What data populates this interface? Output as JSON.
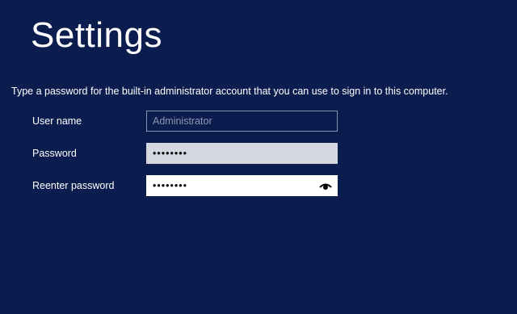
{
  "page": {
    "title": "Settings",
    "instruction": "Type a password for the built-in administrator account that you can use to sign in to this computer."
  },
  "form": {
    "username": {
      "label": "User name",
      "placeholder": "Administrator"
    },
    "password": {
      "label": "Password",
      "value": "••••••••"
    },
    "reenter": {
      "label": "Reenter password",
      "value": "••••••••"
    }
  },
  "icons": {
    "reveal": "eye-icon"
  },
  "colors": {
    "background": "#0b1d4e",
    "text": "#ffffff",
    "username_border": "#8891ad",
    "password_bg": "#d5d8e0",
    "reenter_bg": "#ffffff"
  }
}
